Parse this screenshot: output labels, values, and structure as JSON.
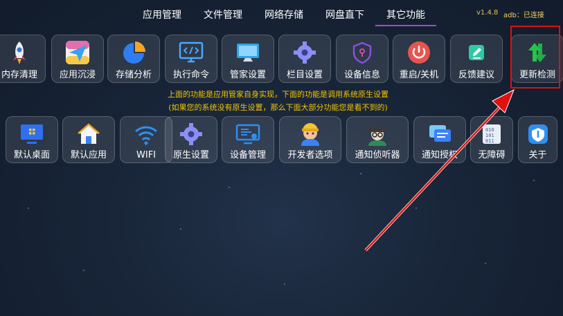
{
  "tabs": [
    {
      "label": "应用管理",
      "active": false
    },
    {
      "label": "文件管理",
      "active": false
    },
    {
      "label": "网络存储",
      "active": false
    },
    {
      "label": "网盘直下",
      "active": false
    },
    {
      "label": "其它功能",
      "active": true
    }
  ],
  "version": "v1.4.8",
  "adb_status": "adb：已连接",
  "row1": [
    {
      "label": "内存清理",
      "icon": "rocket-icon"
    },
    {
      "label": "应用沉浸",
      "icon": "paper-plane-icon"
    },
    {
      "label": "存储分析",
      "icon": "pie-chart-icon"
    },
    {
      "label": "执行命令",
      "icon": "code-monitor-icon"
    },
    {
      "label": "管家设置",
      "icon": "monitor-icon"
    },
    {
      "label": "栏目设置",
      "icon": "gear-icon"
    },
    {
      "label": "设备信息",
      "icon": "shield-icon"
    },
    {
      "label": "重启/关机",
      "icon": "power-icon"
    },
    {
      "label": "反馈建议",
      "icon": "edit-icon"
    },
    {
      "label": "更新检测",
      "icon": "update-arrows-icon"
    }
  ],
  "note": {
    "line1": "上面的功能是应用管家自身实现，下面的功能是调用系统原生设置",
    "line2": "(如果您的系统没有原生设置，那么下面大部分功能您是看不到的)"
  },
  "row2": [
    {
      "label": "默认桌面",
      "icon": "desktop-icon"
    },
    {
      "label": "默认应用",
      "icon": "home-icon"
    },
    {
      "label": "WIFI",
      "icon": "wifi-icon"
    },
    {
      "label": "原生设置",
      "icon": "gear-icon"
    },
    {
      "label": "设备管理",
      "icon": "device-manager-icon"
    },
    {
      "label": "开发者选项",
      "icon": "developer-icon"
    },
    {
      "label": "通知侦听器",
      "icon": "detective-icon"
    },
    {
      "label": "通知授权",
      "icon": "notification-icon"
    },
    {
      "label": "无障碍",
      "icon": "accessibility-icon"
    },
    {
      "label": "关于",
      "icon": "about-icon"
    }
  ],
  "colors": {
    "tab_active_underline": "#b73fd9",
    "note_text": "#f5c400",
    "highlight_box": "#e01010",
    "arrow": "#e01010"
  }
}
